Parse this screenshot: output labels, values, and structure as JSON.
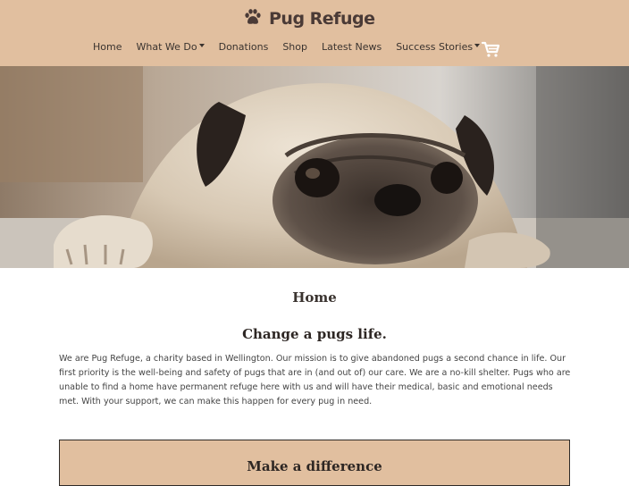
{
  "brand": {
    "name": "Pug Refuge",
    "icon": "paw-icon",
    "color": "#4a3a36"
  },
  "header": {
    "background": "#e1bf9f"
  },
  "nav": {
    "items": [
      {
        "label": "Home",
        "dropdown": false
      },
      {
        "label": "What We Do",
        "dropdown": true
      },
      {
        "label": "Donations",
        "dropdown": false
      },
      {
        "label": "Shop",
        "dropdown": false
      },
      {
        "label": "Latest News",
        "dropdown": false
      },
      {
        "label": "Success Stories",
        "dropdown": true
      }
    ],
    "cart_icon": "cart-icon"
  },
  "hero": {
    "description": "pug lying on floor photo"
  },
  "main": {
    "page_title": "Home",
    "heading": "Change a pugs life.",
    "intro": "We are Pug Refuge, a charity based in Wellington. Our mission is to give abandoned pugs a second chance in life. Our first priority is the well-being and safety of pugs that are in (and out of) our care. We are a no-kill shelter. Pugs who are unable to find a home have permanent refuge here with us and will have their medical, basic and emotional needs met. With your support, we can make this happen for every pug in need.",
    "cta_title": "Make a difference"
  }
}
